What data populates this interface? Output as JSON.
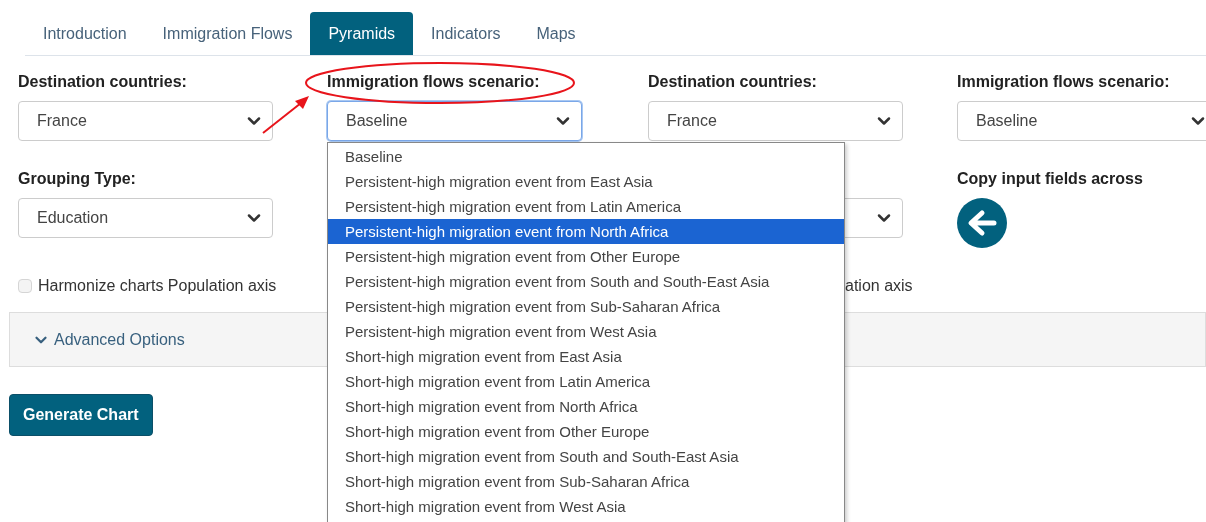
{
  "tabs": [
    {
      "label": "Introduction",
      "selected": false
    },
    {
      "label": "Immigration Flows",
      "selected": false
    },
    {
      "label": "Pyramids",
      "selected": true
    },
    {
      "label": "Indicators",
      "selected": false
    },
    {
      "label": "Maps",
      "selected": false
    }
  ],
  "left": {
    "destination": {
      "label": "Destination countries:",
      "value": "France"
    },
    "scenario": {
      "label": "Immigration flows scenario:",
      "value": "Baseline",
      "open": true
    },
    "grouping": {
      "label": "Grouping Type:",
      "value": "Education"
    },
    "harmonize": {
      "label": "Harmonize charts Population axis",
      "checked": false
    }
  },
  "right": {
    "destination": {
      "label": "Destination countries:",
      "value": "France"
    },
    "scenario": {
      "label": "Immigration flows scenario:",
      "value": "Baseline",
      "open": false
    },
    "harmonize": {
      "label": "ation axis"
    }
  },
  "copy": {
    "label": "Copy input fields across"
  },
  "options": [
    {
      "label": "Baseline",
      "selected": false
    },
    {
      "label": "Persistent-high migration event from East Asia",
      "selected": false
    },
    {
      "label": "Persistent-high migration event from Latin America",
      "selected": false
    },
    {
      "label": "Persistent-high migration event from North Africa",
      "selected": true
    },
    {
      "label": "Persistent-high migration event from Other Europe",
      "selected": false
    },
    {
      "label": "Persistent-high migration event from South and South-East Asia",
      "selected": false
    },
    {
      "label": "Persistent-high migration event from Sub-Saharan Africa",
      "selected": false
    },
    {
      "label": "Persistent-high migration event from West Asia",
      "selected": false
    },
    {
      "label": "Short-high migration event from East Asia",
      "selected": false
    },
    {
      "label": "Short-high migration event from Latin America",
      "selected": false
    },
    {
      "label": "Short-high migration event from North Africa",
      "selected": false
    },
    {
      "label": "Short-high migration event from Other Europe",
      "selected": false
    },
    {
      "label": "Short-high migration event from South and South-East Asia",
      "selected": false
    },
    {
      "label": "Short-high migration event from Sub-Saharan Africa",
      "selected": false
    },
    {
      "label": "Short-high migration event from West Asia",
      "selected": false
    }
  ],
  "advanced": {
    "label": "Advanced Options",
    "expanded": false
  },
  "generate": {
    "label": "Generate Chart"
  }
}
